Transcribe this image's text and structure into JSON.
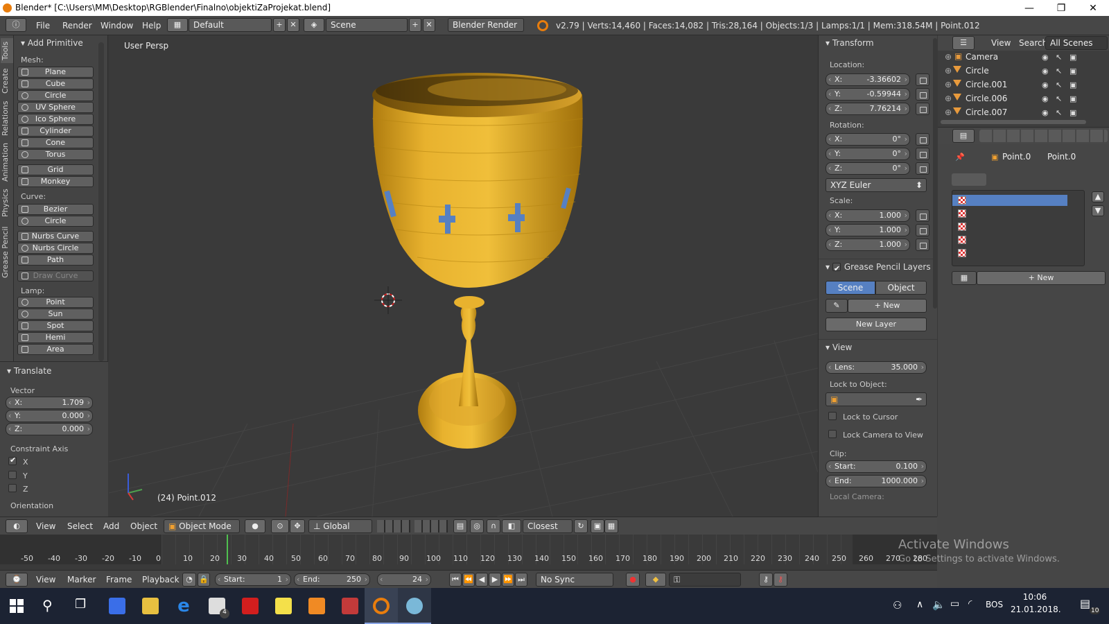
{
  "window": {
    "title": "Blender* [C:\\Users\\MM\\Desktop\\RGBlender\\Finalno\\objektiZaProjekat.blend]",
    "minimize": "—",
    "maximize": "❐",
    "close": "✕"
  },
  "infobar": {
    "menus": [
      "File",
      "Render",
      "Window",
      "Help"
    ],
    "layout": "Default",
    "scene": "Scene",
    "engine": "Blender Render",
    "stats": "v2.79 | Verts:14,460 | Faces:14,082 | Tris:28,164 | Objects:1/3 | Lamps:1/1 | Mem:318.54M | Point.012"
  },
  "tooltabs": [
    "Tools",
    "Create",
    "Relations",
    "Animation",
    "Physics",
    "Grease Pencil"
  ],
  "toolshelf": {
    "header": "Add Primitive",
    "mesh_label": "Mesh:",
    "mesh": [
      "Plane",
      "Cube",
      "Circle",
      "UV Sphere",
      "Ico Sphere",
      "Cylinder",
      "Cone",
      "Torus",
      "Grid",
      "Monkey"
    ],
    "curve_label": "Curve:",
    "curve": [
      "Bezier",
      "Circle",
      "Nurbs Curve",
      "Nurbs Circle",
      "Path",
      "Draw Curve"
    ],
    "lamp_label": "Lamp:",
    "lamp": [
      "Point",
      "Sun",
      "Spot",
      "Hemi",
      "Area"
    ]
  },
  "operator": {
    "header": "Translate",
    "vector_label": "Vector",
    "x_label": "X:",
    "x": "1.709",
    "y_label": "Y:",
    "y": "0.000",
    "z_label": "Z:",
    "z": "0.000",
    "constraint_label": "Constraint Axis",
    "ax_x": "X",
    "ax_y": "Y",
    "ax_z": "Z",
    "orientation_label": "Orientation"
  },
  "viewport": {
    "label": "User Persp",
    "object": "(24) Point.012"
  },
  "npanel": {
    "transform": "Transform",
    "location_label": "Location:",
    "loc_x": "-3.36602",
    "loc_y": "-0.59944",
    "loc_z": "7.76214",
    "rotation_label": "Rotation:",
    "rot_x": "0°",
    "rot_y": "0°",
    "rot_z": "0°",
    "rot_mode": "XYZ Euler",
    "scale_label": "Scale:",
    "sc_x": "1.000",
    "sc_y": "1.000",
    "sc_z": "1.000",
    "x_label": "X:",
    "y_label": "Y:",
    "z_label": "Z:",
    "gp_layers": "Grease Pencil Layers",
    "gp_scene": "Scene",
    "gp_object": "Object",
    "gp_new": "New",
    "gp_new_layer": "New Layer",
    "view": "View",
    "lens_label": "Lens:",
    "lens": "35.000",
    "lock_obj_label": "Lock to Object:",
    "lock_cursor": "Lock to Cursor",
    "lock_camera": "Lock Camera to View",
    "clip_label": "Clip:",
    "clip_start_label": "Start:",
    "clip_start": "0.100",
    "clip_end_label": "End:",
    "clip_end": "1000.000",
    "local_camera": "Local Camera:"
  },
  "outliner": {
    "view": "View",
    "search": "Search",
    "scenes": "All Scenes",
    "items": [
      "Camera",
      "Circle",
      "Circle.001",
      "Circle.006",
      "Circle.007"
    ]
  },
  "properties": {
    "crumb1": "Point.0",
    "crumb2": "Point.0",
    "new": "New"
  },
  "view3d_header": {
    "view": "View",
    "select": "Select",
    "add": "Add",
    "object": "Object",
    "mode": "Object Mode",
    "orientation": "Global",
    "snap": "Closest"
  },
  "timeline": {
    "ticks": [
      "-50",
      "-40",
      "-30",
      "-20",
      "-10",
      "0",
      "10",
      "20",
      "30",
      "40",
      "50",
      "60",
      "70",
      "80",
      "90",
      "100",
      "110",
      "120",
      "130",
      "140",
      "150",
      "160",
      "170",
      "180",
      "190",
      "200",
      "210",
      "220",
      "230",
      "240",
      "250",
      "260",
      "270",
      "280"
    ],
    "current_frame": 24
  },
  "timeline_header": {
    "view": "View",
    "marker": "Marker",
    "frame": "Frame",
    "playback": "Playback",
    "start_label": "Start:",
    "start": "1",
    "end_label": "End:",
    "end": "250",
    "current": "24",
    "sync": "No Sync"
  },
  "watermark": {
    "line1": "Activate Windows",
    "line2": "Go to Settings to activate Windows."
  },
  "taskbar": {
    "lang": "BOS",
    "time": "10:06",
    "date": "21.01.2018.",
    "mail_badge": "4",
    "notif": "10"
  },
  "colors": {
    "goblet": "#e0a82a",
    "goblet_dark": "#b07d10",
    "accent_blue": "#5680c2",
    "blender_orange": "#e87d0d"
  }
}
